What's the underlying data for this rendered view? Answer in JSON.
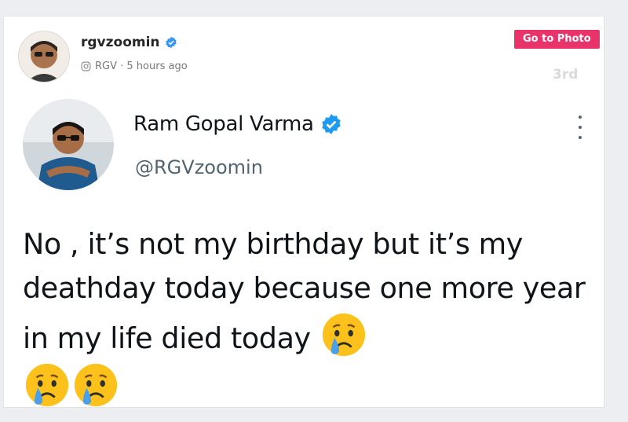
{
  "post": {
    "username": "rgvzoomin",
    "meta": "RGV · 5 hours ago",
    "go_to_photo": "Go to Photo",
    "page_marker": "3rd"
  },
  "tweet": {
    "name": "Ram Gopal Varma",
    "handle": "@RGVzoomin",
    "text": "No ,  it’s not my birthday but it’s my deathday today because one more year in my life died today"
  },
  "icons": {
    "verified": "verified-badge-icon",
    "instagram": "instagram-icon",
    "more": "more-options-icon",
    "emoji": "crying-face-emoji"
  },
  "colors": {
    "accent": "#e8336b",
    "verified": "#1d9bf0",
    "instagram_verified": "#3897f0"
  }
}
